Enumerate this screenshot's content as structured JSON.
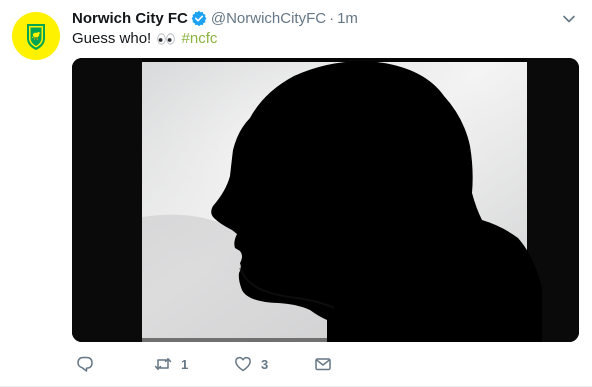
{
  "account": {
    "display_name": "Norwich City FC",
    "handle": "@NorwichCityFC",
    "separator": "·",
    "timestamp": "1m",
    "verified": true
  },
  "tweet": {
    "text_before": "Guess who! ",
    "emoji": "eyes-emoji",
    "hashtag": "#ncfc"
  },
  "media": {
    "description_icon": "silhouette-photo"
  },
  "actions": {
    "reply_count": "",
    "retweet_count": "1",
    "like_count": "3"
  },
  "colors": {
    "brand_yellow": "#fff200",
    "brand_green": "#00a650",
    "verified_blue": "#1da1f2",
    "hashtag_green": "#8bb33f",
    "text_gray": "#657786"
  }
}
